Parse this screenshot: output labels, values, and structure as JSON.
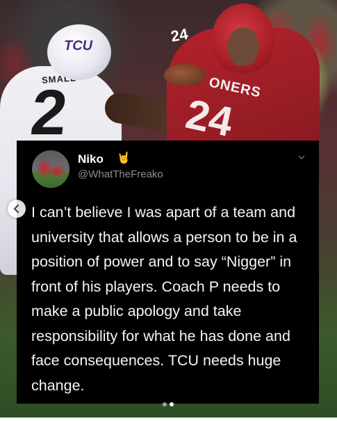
{
  "post": {
    "photo": {
      "left_player_name": "SMALL",
      "left_player_number": "2",
      "left_helmet_logo": "TCU",
      "right_jersey_text": "ONERS",
      "right_jersey_number": "24",
      "right_shoulder_number": "24"
    },
    "tweet": {
      "display_name": "Niko",
      "name_emoji": "🤘",
      "handle": "@WhatTheFreako",
      "text": "I can’t believe I was apart of a team and university that allows a person to be in a position of power and to say “Nigger” in front of his players. Coach P needs to make a public apology and take responsibility for what he has done and face consequences. TCU needs huge change."
    },
    "carousel": {
      "prev_icon": "chevron-left-icon",
      "current_slide": 2,
      "total_slides": 2
    }
  }
}
